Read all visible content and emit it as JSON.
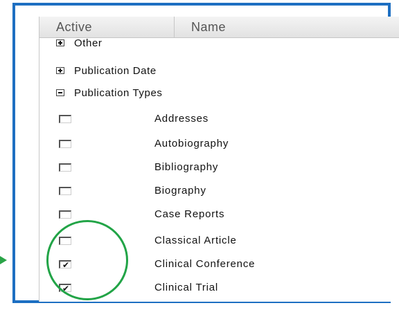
{
  "columns": {
    "active": "Active",
    "name": "Name"
  },
  "groups": [
    {
      "label": "Other",
      "state": "collapsed",
      "icon": "plus-box-icon"
    },
    {
      "label": "Publication Date",
      "state": "collapsed",
      "icon": "plus-box-icon"
    },
    {
      "label": "Publication Types",
      "state": "expanded",
      "icon": "minus-box-icon"
    }
  ],
  "publication_types": [
    {
      "label": "Addresses",
      "checked": false
    },
    {
      "label": "Autobiography",
      "checked": false
    },
    {
      "label": "Bibliography",
      "checked": false
    },
    {
      "label": "Biography",
      "checked": false
    },
    {
      "label": "Case Reports",
      "checked": false
    },
    {
      "label": "Classical Article",
      "checked": false
    },
    {
      "label": "Clinical Conference",
      "checked": true
    },
    {
      "label": "Clinical Trial",
      "checked": true
    }
  ],
  "colors": {
    "frame": "#1d6fc2",
    "highlight": "#22a447"
  }
}
